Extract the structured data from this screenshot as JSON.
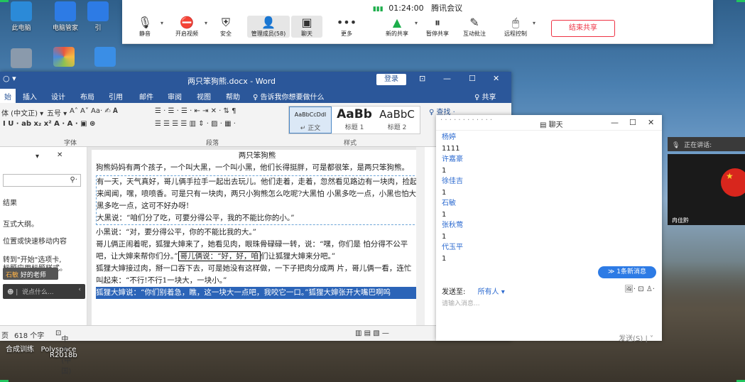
{
  "desktop": {
    "icons": [
      {
        "label": "此电脑",
        "color": "#2b8ad8"
      },
      {
        "label": "电脑管家",
        "color": "#2d7be5"
      },
      {
        "label": "引",
        "color": "#2d7be5"
      },
      {
        "label": "",
        "color": "#8a9aac"
      },
      {
        "label": "",
        "color": "#e9573f"
      },
      {
        "label": "",
        "color": "#3a8ee6"
      }
    ],
    "bottom_text_1": "合成训练",
    "bottom_text_2": "Polyspace",
    "bottom_text_3": "R2018b"
  },
  "meeting": {
    "time": "01:24:00",
    "app": "腾讯会议",
    "items": [
      {
        "label": "静音",
        "icon": "mic-icon"
      },
      {
        "label": "开启视频",
        "icon": "camera-off-icon"
      },
      {
        "label": "安全",
        "icon": "shield-icon"
      },
      {
        "label": "管理成员(58)",
        "icon": "members-icon"
      },
      {
        "label": "聊天",
        "icon": "chat-icon"
      },
      {
        "label": "更多",
        "icon": "more-icon"
      },
      {
        "label": "新的共享",
        "icon": "share-icon"
      },
      {
        "label": "暂停共享",
        "icon": "pause-icon"
      },
      {
        "label": "互动批注",
        "icon": "annotate-icon"
      },
      {
        "label": "远程控制",
        "icon": "remote-icon"
      }
    ],
    "end_share": "结束共享"
  },
  "word": {
    "title": "两只笨狗熊.docx  -  Word",
    "login": "登录",
    "tabs": [
      "始",
      "插入",
      "设计",
      "布局",
      "引用",
      "邮件",
      "审阅",
      "视图",
      "帮助",
      "♀ 告诉我你想要做什么",
      "♀ 共享"
    ],
    "font_name": "体 (中文正)",
    "font_size": "五号",
    "groups": {
      "font": "字体",
      "paragraph": "段落",
      "styles": "样式"
    },
    "styles": [
      {
        "big": "AaBbCcDdI",
        "label": "↵ 正文"
      },
      {
        "big": "AaBb",
        "label": "标题 1"
      },
      {
        "big": "AaBbC",
        "label": "标题 2"
      }
    ],
    "find": "♀ 查找 ·",
    "nav": {
      "results": "结果",
      "line1": "互式大纲。",
      "line2": "位置或快速移动内容",
      "line3": "转到\"开始\"选项卡,",
      "line4": "标题应用标题样式。",
      "tip_name": "石敏",
      "tip_text": "好的老师",
      "chat_placeholder": "说点什么..."
    },
    "doc": {
      "title": "两只笨狗熊",
      "p1": "狗熊妈妈有两个孩子，一个叫大黑，一个叫小黑，他们长得挺胖，可是都很笨，是两只笨狗熊。",
      "p2": "有一天，天气真好，哥儿俩手拉手一起出去玩儿。他们走着，走着，忽然看见路边有一块肉，捡起来闻闻，嘿，喷喷香。可是只有一块肉，两只小狗熊怎么吃呢?大黑怕 小黑多吃一点，小黑也怕大黑多吃一点，这可不好办呀!",
      "p3": "大黑说：“咱们分了吃，可要分得公平，我的不能比你的小。”",
      "p4": "小黑说：“对，要分得公平，你的不能比我的大。”",
      "p5a": "哥儿俩正闹着呢，狐狸大婶来了，她看见肉，眼珠骨碌碌一转，说：“嘿，你们是 怕分得不公平吧，让大婶来帮你们分。”",
      "p5b": "哥儿俩说：“好，好，咱",
      "p5c": "们让狐狸大婶来分吧。”",
      "p6": "狐狸大婶接过肉，掰一口吞下去，可是她没有这样做，一下子把肉分成两 片，哥儿俩一看，连忙叫起来：“不行!不行1一块大，一块小。”",
      "p7": "狐狸大婶说：“你们别着急，瞧，这一块大一点吧，我咬它一口。”狐狸大婶张开大嘴巴啊呜"
    },
    "status": {
      "page": "页",
      "words": "618 个字",
      "lang": "中文(中国)"
    }
  },
  "chat": {
    "title": "聊天",
    "messages": [
      {
        "name": "杨婷",
        "text": "1111"
      },
      {
        "name": "许嘉豪",
        "text": "1"
      },
      {
        "name": "徐佳吉",
        "text": "1"
      },
      {
        "name": "石敏",
        "text": "1"
      },
      {
        "name": "张秋莺",
        "text": "1"
      },
      {
        "name": "代玉平",
        "text": "1"
      }
    ],
    "new_msg": "≫ 1条新消息",
    "send_to_label": "发送至:",
    "send_to": "所有人 ▾",
    "input_placeholder": "请输入消息...",
    "send": "发送(S)"
  },
  "right_panel": {
    "speaking": "正在讲话:",
    "speaker": "冉佳黔"
  }
}
